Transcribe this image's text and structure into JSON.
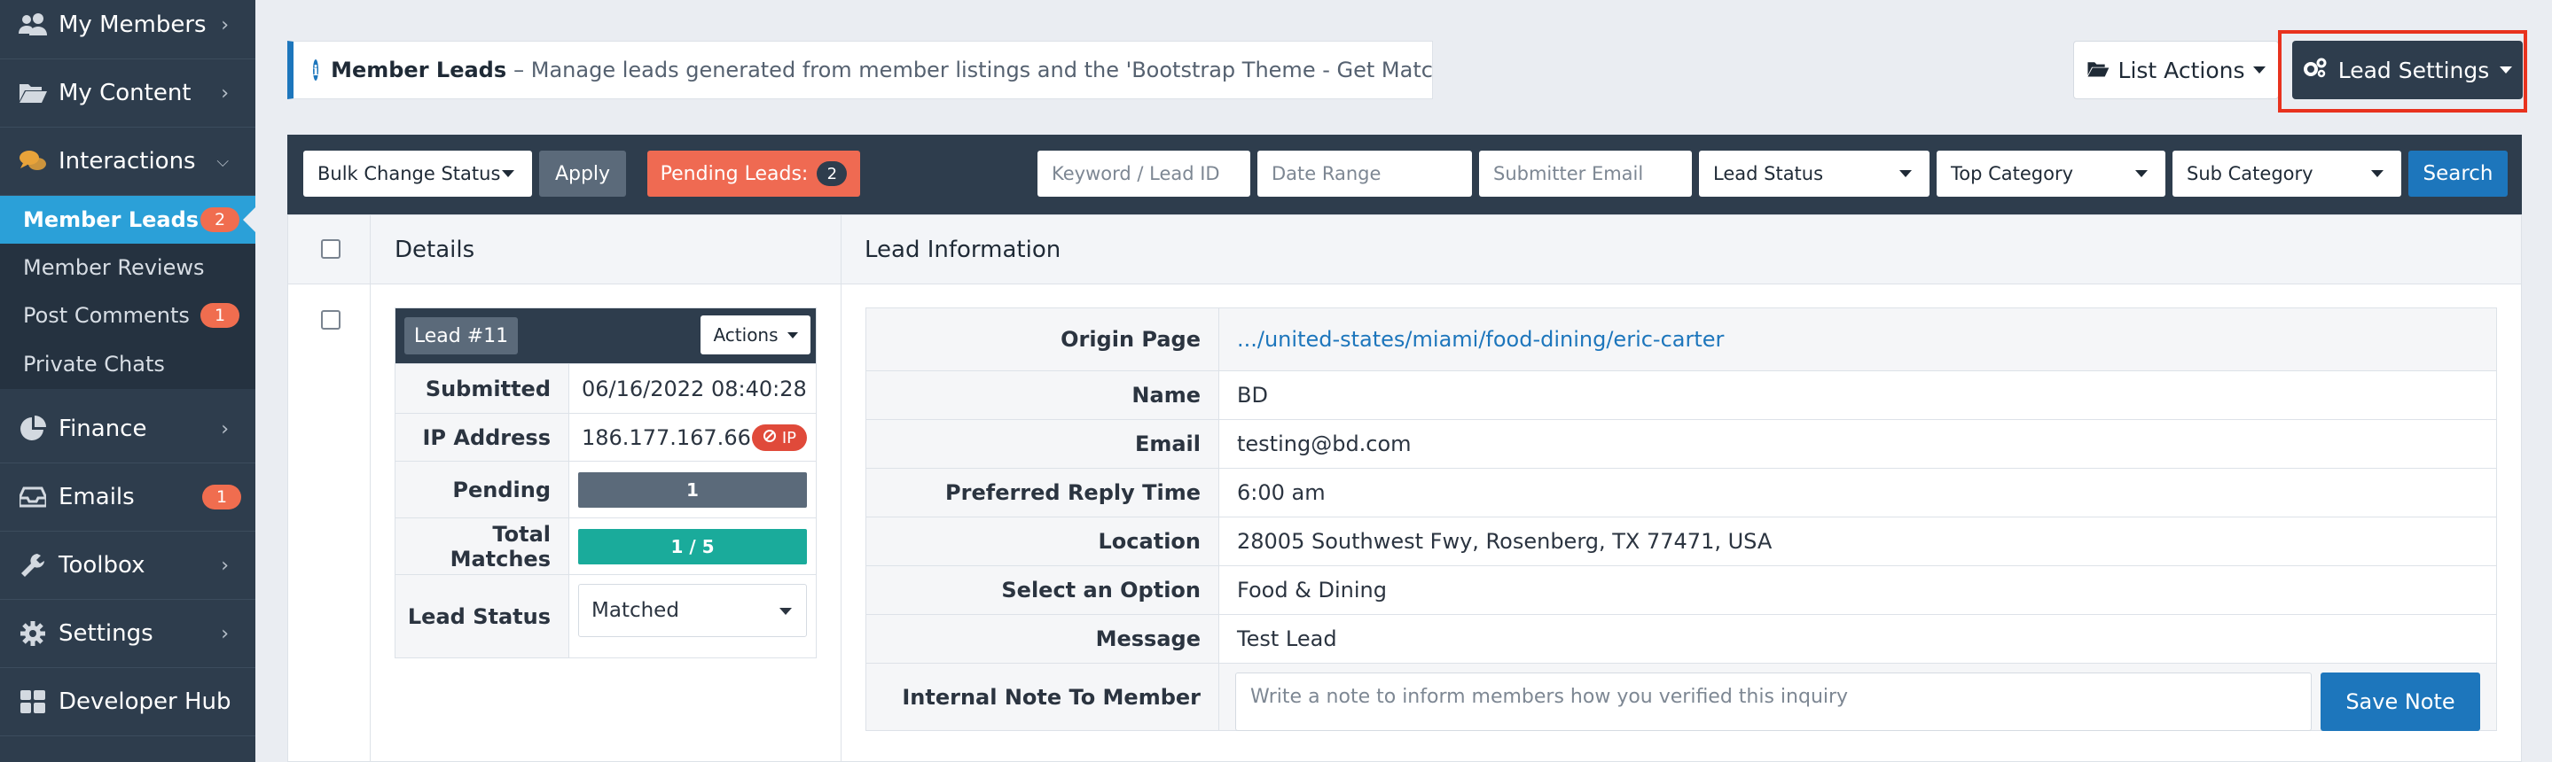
{
  "sidebar": {
    "items": [
      {
        "label": "My Members",
        "icon": "users-icon"
      },
      {
        "label": "My Content",
        "icon": "folder-open-icon"
      },
      {
        "label": "Interactions",
        "icon": "comments-icon"
      },
      {
        "label": "Finance",
        "icon": "pie-chart-icon"
      },
      {
        "label": "Emails",
        "icon": "inbox-icon",
        "badge": "1"
      },
      {
        "label": "Toolbox",
        "icon": "wrench-icon"
      },
      {
        "label": "Settings",
        "icon": "gear-icon"
      },
      {
        "label": "Developer Hub",
        "icon": "grid-icon"
      }
    ],
    "subitems": [
      {
        "label": "Member Leads",
        "badge": "2"
      },
      {
        "label": "Member Reviews"
      },
      {
        "label": "Post Comments",
        "badge": "1"
      },
      {
        "label": "Private Chats"
      }
    ]
  },
  "header": {
    "title": "Member Leads",
    "description": "– Manage leads generated from member listings and the 'Bootstrap Theme - Get Matched' form.",
    "list_actions": "List Actions",
    "lead_settings": "Lead Settings"
  },
  "filters": {
    "bulk_status": "Bulk Change Status",
    "apply": "Apply",
    "pending_label": "Pending Leads:",
    "pending_count": "2",
    "keyword_placeholder": "Keyword / Lead ID",
    "date_placeholder": "Date Range",
    "email_placeholder": "Submitter Email",
    "lead_status": "Lead Status",
    "top_category": "Top Category",
    "sub_category": "Sub Category",
    "search": "Search"
  },
  "table": {
    "col_details": "Details",
    "col_info": "Lead Information"
  },
  "lead": {
    "number": "Lead #11",
    "actions": "Actions",
    "submitted_label": "Submitted",
    "submitted": "06/16/2022 08:40:28",
    "ip_label": "IP Address",
    "ip": "186.177.167.66",
    "ip_badge": "IP",
    "pending_label": "Pending",
    "pending": "1",
    "pending_fraction": 1.0,
    "matches_label": "Total Matches",
    "matches": "1 / 5",
    "matches_fraction": 1.0,
    "status_label": "Lead Status",
    "status": "Matched",
    "colors": {
      "pending_bar": "#5b6a7a",
      "matches_bar": "#1aab9b",
      "accent": "#1d76bc",
      "badge": "#f06d4f"
    }
  },
  "lead_info": {
    "origin_label": "Origin Page",
    "origin": ".../united-states/miami/food-dining/eric-carter",
    "name_label": "Name",
    "name": "BD",
    "email_label": "Email",
    "email": "testing@bd.com",
    "reply_label": "Preferred Reply Time",
    "reply": "6:00 am",
    "location_label": "Location",
    "location": "28005 Southwest Fwy, Rosenberg, TX 77471, USA",
    "option_label": "Select an Option",
    "option": "Food & Dining",
    "message_label": "Message",
    "message": "Test Lead",
    "note_label": "Internal Note To Member",
    "note_placeholder": "Write a note to inform members how you verified this inquiry",
    "save_note": "Save Note"
  }
}
